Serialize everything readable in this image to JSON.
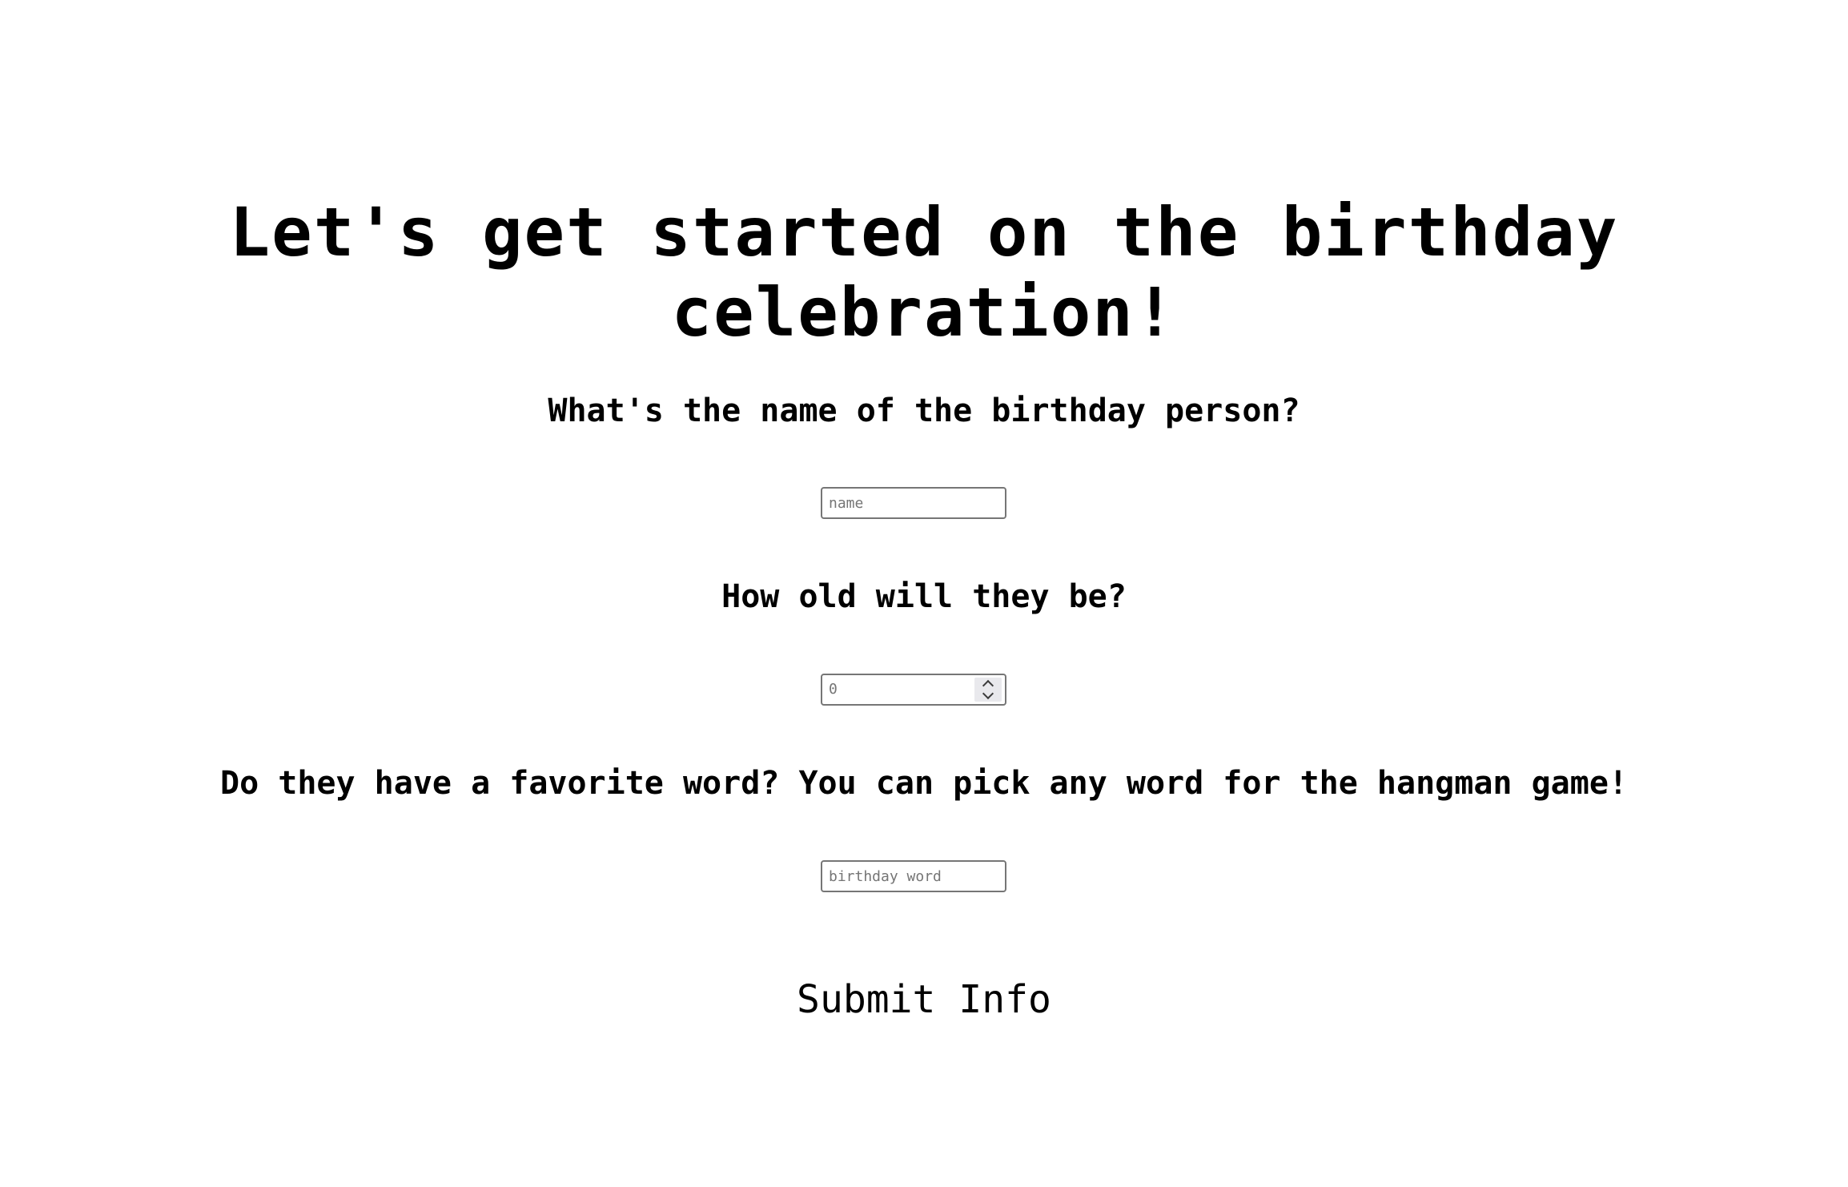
{
  "page": {
    "title": "Let's get started on the birthday celebration!"
  },
  "form": {
    "name_question": "What's the name of the birthday person?",
    "name_placeholder": "name",
    "age_question": "How old will they be?",
    "age_value": "0",
    "word_question": "Do they have a favorite word? You can pick any word for the hangman game!",
    "word_placeholder": "birthday word",
    "submit_label": "Submit Info"
  },
  "icons": {
    "age_spinner_up": "chevron-up-icon",
    "age_spinner_down": "chevron-down-icon"
  }
}
